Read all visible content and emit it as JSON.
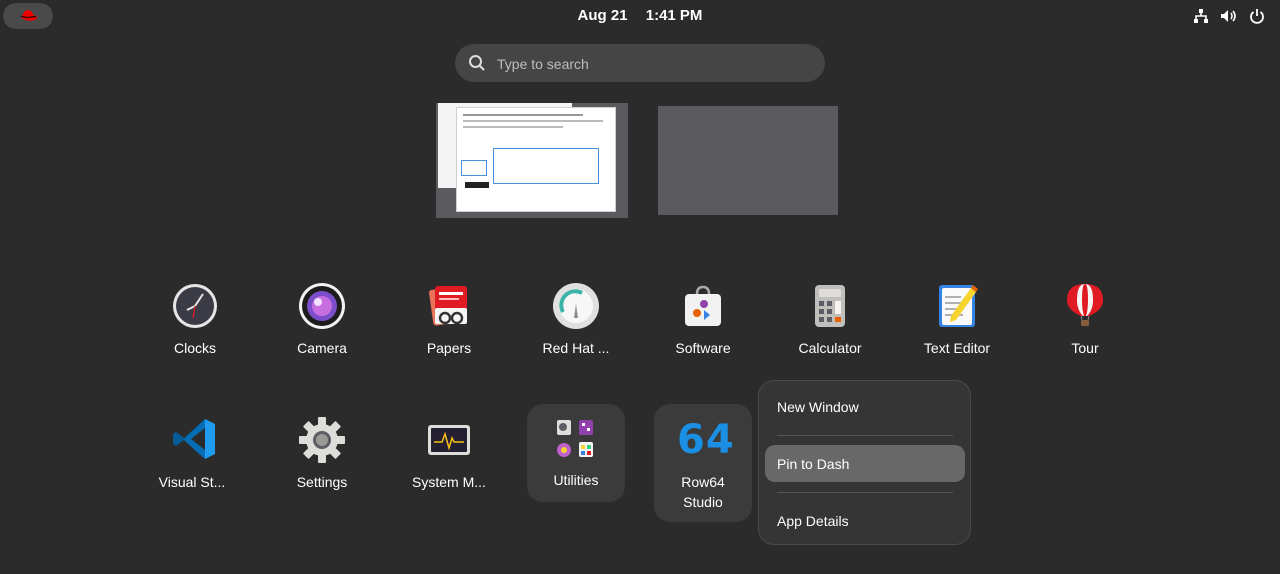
{
  "topbar": {
    "date": "Aug 21",
    "time": "1:41 PM",
    "icons": [
      "redhat-logo-icon",
      "network-icon",
      "volume-icon",
      "power-icon"
    ]
  },
  "search": {
    "placeholder": "Type to search"
  },
  "workspaces": [
    {
      "label": "workspace-1"
    },
    {
      "label": "workspace-2"
    }
  ],
  "apps_row1": [
    {
      "label": "Clocks",
      "icon": "clocks-icon"
    },
    {
      "label": "Camera",
      "icon": "camera-icon"
    },
    {
      "label": "Papers",
      "icon": "papers-icon"
    },
    {
      "label": "Red Hat ...",
      "icon": "redhat-insights-icon"
    },
    {
      "label": "Software",
      "icon": "software-icon"
    },
    {
      "label": "Calculator",
      "icon": "calculator-icon"
    },
    {
      "label": "Text Editor",
      "icon": "text-editor-icon"
    },
    {
      "label": "Tour",
      "icon": "tour-icon"
    }
  ],
  "apps_row2": [
    {
      "label": "Visual St...",
      "icon": "vscode-icon"
    },
    {
      "label": "Settings",
      "icon": "settings-icon"
    },
    {
      "label": "System M...",
      "icon": "system-monitor-icon"
    },
    {
      "label": "Utilities",
      "icon": "utilities-folder-icon"
    },
    {
      "label_line1": "Row64",
      "label_line2": "Studio",
      "icon": "row64-icon",
      "icon_text": "64"
    }
  ],
  "context_menu": {
    "items": [
      "New Window",
      "Pin to Dash",
      "App Details"
    ],
    "highlighted": "Pin to Dash"
  },
  "colors": {
    "background": "#2b2b2b",
    "menu_bg": "#353535",
    "highlight": "#686868",
    "redhat_red": "#ee0000",
    "row64_blue": "#1a8fe3"
  }
}
